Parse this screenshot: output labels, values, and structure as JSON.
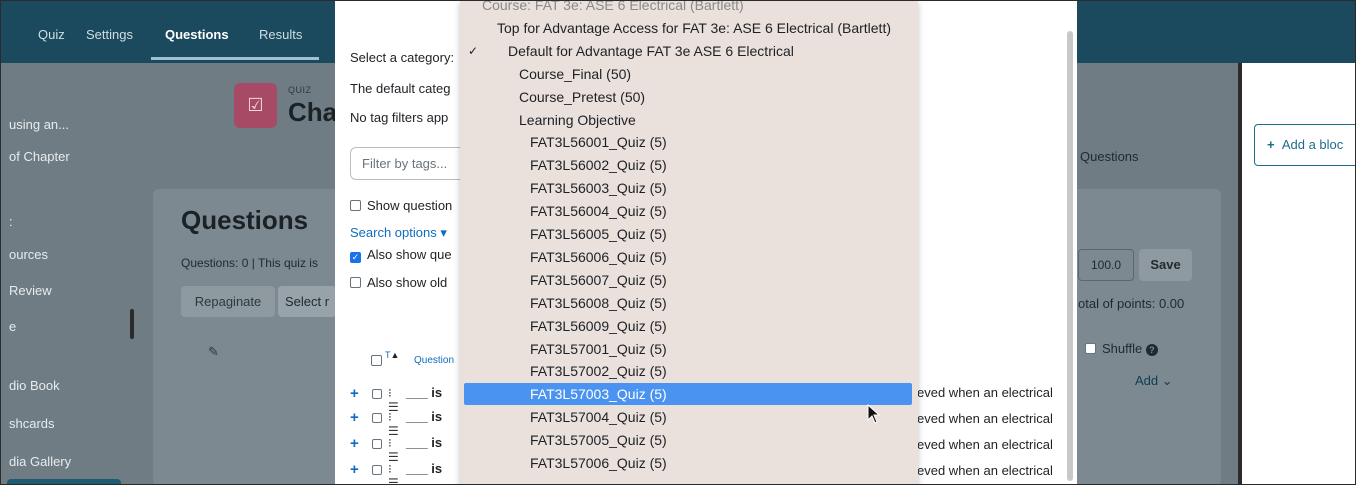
{
  "topnav": {
    "items": [
      "Quiz",
      "Settings",
      "Questions",
      "Results"
    ],
    "active": "Questions"
  },
  "drawer": {
    "items": [
      "using an...",
      "of Chapter",
      ":",
      "ources",
      "Review",
      "e",
      "dio Book",
      "shcards",
      "dia Gallery"
    ]
  },
  "quiz_header": {
    "kicker": "QUIZ",
    "title": "Cha"
  },
  "questions_panel": {
    "heading": "Questions",
    "summary": "Questions: 0 | This quiz is",
    "repaginate": "Repaginate",
    "select_multiple": "Select r",
    "max_grade": "100.0",
    "save": "Save",
    "total_points": "otal of points: 0.00",
    "shuffle": "Shuffle",
    "add": "Add",
    "questions_tab": "Questions"
  },
  "right_pane": {
    "add_block": "Add a bloc"
  },
  "modal": {
    "select_category_label": "Select a category:",
    "default_category_text": "The default categ",
    "no_tag_filters": "No tag filters app",
    "filter_placeholder": "Filter by tags...",
    "show_question_text": "Show question",
    "search_options": "Search options",
    "also_show_questions": "Also show que",
    "also_show_old": "Also show old",
    "table_header_t": "T",
    "table_header_question": "Question",
    "rows": [
      {
        "text": "___ is",
        "tail": "eved when an electrical"
      },
      {
        "text": "___ is",
        "tail": "eved when an electrical"
      },
      {
        "text": "___ is",
        "tail": "eved when an electrical"
      },
      {
        "text": "___ is",
        "tail": "eved when an electrical"
      }
    ]
  },
  "category_dropdown": {
    "options": [
      {
        "label": "Course: FAT 3e: ASE 6 Electrical (Bartlett)",
        "kind": "group",
        "indent": 0
      },
      {
        "label": "Top for Advantage Access for FAT 3e: ASE 6 Electrical (Bartlett)",
        "kind": "option",
        "indent": 0
      },
      {
        "label": "Default for Advantage FAT 3e ASE 6 Electrical",
        "kind": "checked",
        "indent": 1
      },
      {
        "label": "Course_Final (50)",
        "kind": "option",
        "indent": 2
      },
      {
        "label": "Course_Pretest (50)",
        "kind": "option",
        "indent": 2
      },
      {
        "label": "Learning Objective",
        "kind": "option",
        "indent": 2
      },
      {
        "label": "FAT3L56001_Quiz (5)",
        "kind": "option",
        "indent": 3
      },
      {
        "label": "FAT3L56002_Quiz (5)",
        "kind": "option",
        "indent": 3
      },
      {
        "label": "FAT3L56003_Quiz (5)",
        "kind": "option",
        "indent": 3
      },
      {
        "label": "FAT3L56004_Quiz (5)",
        "kind": "option",
        "indent": 3
      },
      {
        "label": "FAT3L56005_Quiz (5)",
        "kind": "option",
        "indent": 3
      },
      {
        "label": "FAT3L56006_Quiz (5)",
        "kind": "option",
        "indent": 3
      },
      {
        "label": "FAT3L56007_Quiz (5)",
        "kind": "option",
        "indent": 3
      },
      {
        "label": "FAT3L56008_Quiz (5)",
        "kind": "option",
        "indent": 3
      },
      {
        "label": "FAT3L56009_Quiz (5)",
        "kind": "option",
        "indent": 3
      },
      {
        "label": "FAT3L57001_Quiz (5)",
        "kind": "option",
        "indent": 3
      },
      {
        "label": "FAT3L57002_Quiz (5)",
        "kind": "option",
        "indent": 3
      },
      {
        "label": "FAT3L57003_Quiz (5)",
        "kind": "selected",
        "indent": 3
      },
      {
        "label": "FAT3L57004_Quiz (5)",
        "kind": "option",
        "indent": 3
      },
      {
        "label": "FAT3L57005_Quiz (5)",
        "kind": "option",
        "indent": 3
      },
      {
        "label": "FAT3L57006_Quiz (5)",
        "kind": "option",
        "indent": 3
      }
    ]
  },
  "colors": {
    "nav": "#1b4a5e",
    "accent": "#0f6cbf",
    "selection": "#4b93f0",
    "quiz_icon": "#a64a66"
  }
}
